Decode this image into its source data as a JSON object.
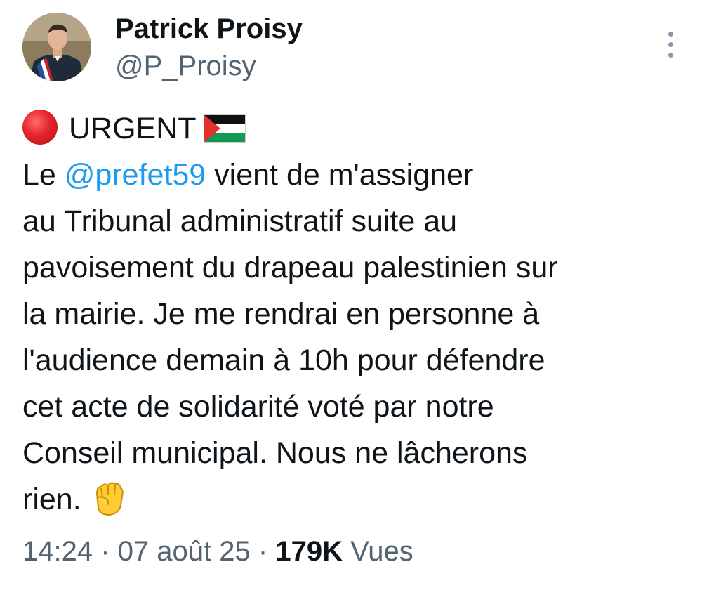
{
  "author": {
    "display_name": "Patrick Proisy",
    "handle": "@P_Proisy",
    "avatar_icon": "person-portrait-avatar"
  },
  "tweet": {
    "line1": {
      "icon": "red-circle-icon",
      "text": "URGENT",
      "flag_icon": "palestinian-flag-icon"
    },
    "line2": {
      "prefix": "Le ",
      "mention": "@prefet59",
      "suffix": " vient de m'assigner"
    },
    "lines": [
      "au Tribunal administratif suite au",
      "pavoisement du drapeau palestinien sur",
      "la mairie. Je me rendrai en personne à",
      "l'audience demain à 10h pour défendre",
      "cet acte de solidarité voté par notre",
      "Conseil municipal. Nous ne lâcherons"
    ],
    "last_line": {
      "text": "rien.",
      "icon": "raised-fist-icon"
    }
  },
  "meta": {
    "time": "14:24",
    "separator": "·",
    "date": "07 août 25",
    "view_count": "179K",
    "views_label": "Vues"
  },
  "colors": {
    "text": "#0f1419",
    "secondary": "#536471",
    "mention": "#1d9bf0"
  }
}
